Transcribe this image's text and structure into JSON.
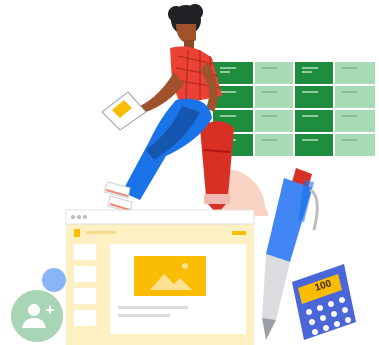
{
  "illustration": {
    "calculator": {
      "display": "100"
    },
    "colors": {
      "spreadsheet_dark": "#1e8e3e",
      "spreadsheet_light": "#a8dab5",
      "shirt": "#ea4335",
      "pants": "#1a73e8",
      "marker": "#d93025",
      "pen_blue": "#4285f4",
      "calculator": "#4a66d9",
      "slide_bg": "#fdf0c2",
      "slide_accent": "#fbbc04",
      "avatar_bg": "#a8d5b5",
      "blue_dot": "#8ab4f8",
      "peach": "#f9d2c4"
    },
    "icons": [
      "add-user-icon",
      "image-icon"
    ]
  }
}
